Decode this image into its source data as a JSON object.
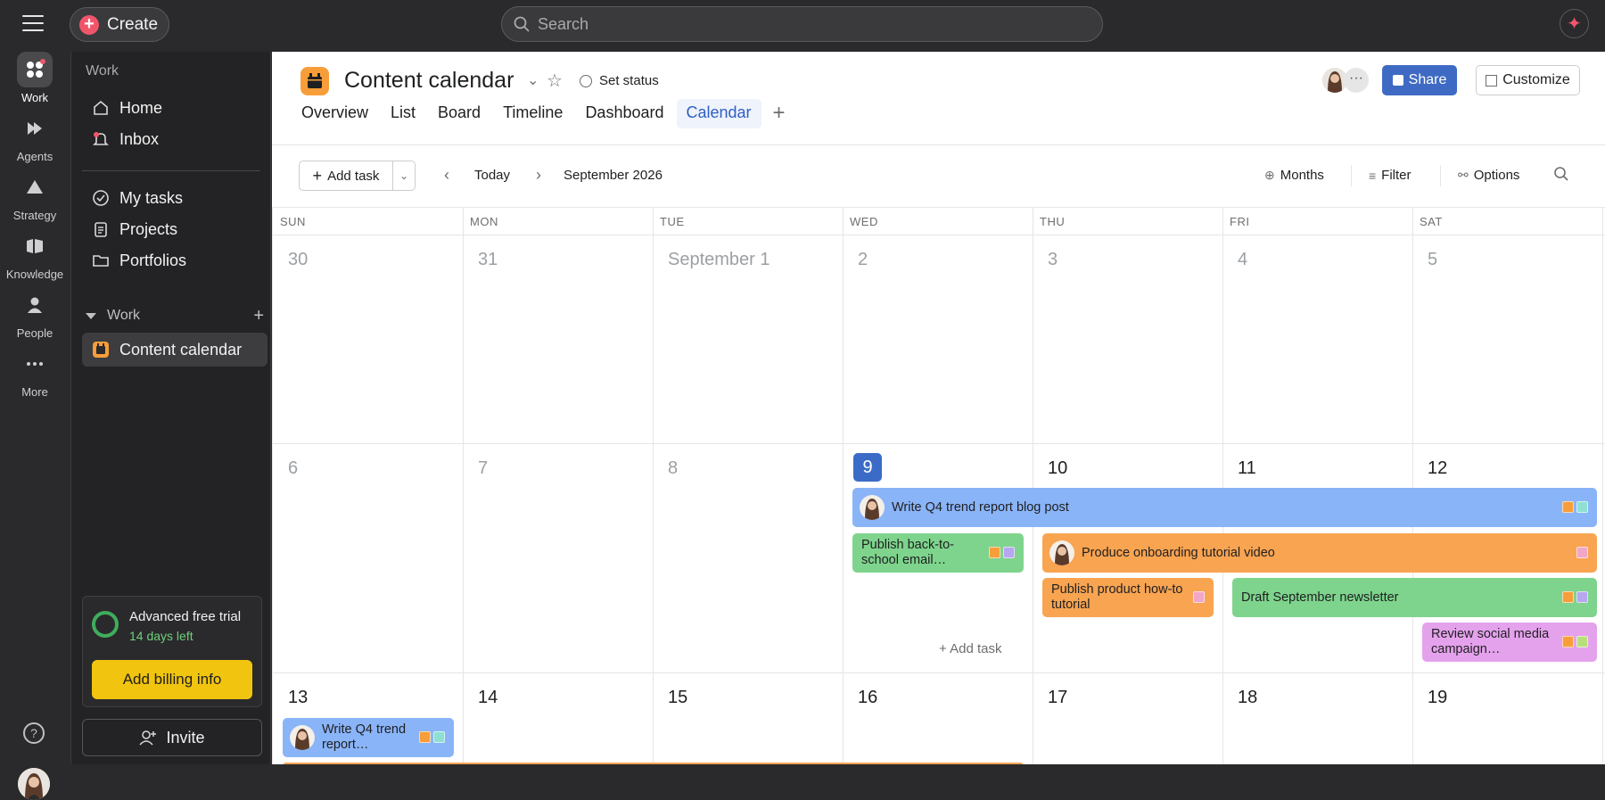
{
  "app": {
    "create_label": "Create",
    "search_placeholder": "Search"
  },
  "rail": [
    {
      "label": "Work",
      "icon": "work-icon"
    },
    {
      "label": "Agents",
      "icon": "agents-icon"
    },
    {
      "label": "Strategy",
      "icon": "strategy-icon"
    },
    {
      "label": "Knowledge",
      "icon": "knowledge-icon"
    },
    {
      "label": "People",
      "icon": "people-icon"
    },
    {
      "label": "More",
      "icon": "more-icon"
    }
  ],
  "sidebar": {
    "heading": "Work",
    "items": [
      {
        "label": "Home"
      },
      {
        "label": "Inbox"
      },
      {
        "label": "My tasks"
      },
      {
        "label": "Projects"
      },
      {
        "label": "Portfolios"
      }
    ],
    "section": "Work",
    "project": "Content calendar",
    "trial_title": "Advanced free trial",
    "trial_days": "14 days left",
    "billing": "Add billing info",
    "invite": "Invite"
  },
  "header": {
    "title": "Content calendar",
    "set_status": "Set status",
    "share": "Share",
    "customize": "Customize",
    "tabs": [
      "Overview",
      "List",
      "Board",
      "Timeline",
      "Dashboard",
      "Calendar"
    ]
  },
  "toolbar": {
    "add_task": "Add task",
    "today": "Today",
    "month": "September 2026",
    "months": "Months",
    "filter": "Filter",
    "options": "Options"
  },
  "calendar": {
    "days_of_week": [
      "SUN",
      "MON",
      "TUE",
      "WED",
      "THU",
      "FRI",
      "SAT"
    ],
    "week1": [
      "30",
      "31",
      "September 1",
      "2",
      "3",
      "4",
      "5"
    ],
    "week2": [
      "6",
      "7",
      "8",
      "9",
      "10",
      "11",
      "12"
    ],
    "week3": [
      "13",
      "14",
      "15",
      "16",
      "17",
      "18",
      "19"
    ],
    "add_task_cell": "Add task",
    "events": [
      {
        "title": "Write Q4 trend report blog post",
        "color": "#8ab4f8"
      },
      {
        "title": "Publish back-to-school email…",
        "color": "#7ed48c"
      },
      {
        "title": "Produce onboarding tutorial video",
        "color": "#f9a451"
      },
      {
        "title": "Publish product how-to tutorial",
        "color": "#f9a451"
      },
      {
        "title": "Draft September newsletter",
        "color": "#7ed48c"
      },
      {
        "title": "Review social media campaign…",
        "color": "#e5a2ec"
      },
      {
        "title": "Write Q4 trend report…",
        "color": "#8ab4f8"
      }
    ]
  },
  "colors": {
    "accent": "#3f6ac4",
    "today": "#3b6bc6",
    "billing": "#f1c40f",
    "brand": "#f0566a",
    "project": "#f79e3a",
    "tag_orange": "#f79e3a",
    "tag_lavender": "#b7a7f0",
    "tag_teal": "#8fe0d2",
    "tag_pink": "#f2a6c8",
    "tag_lime": "#b8e07a"
  }
}
